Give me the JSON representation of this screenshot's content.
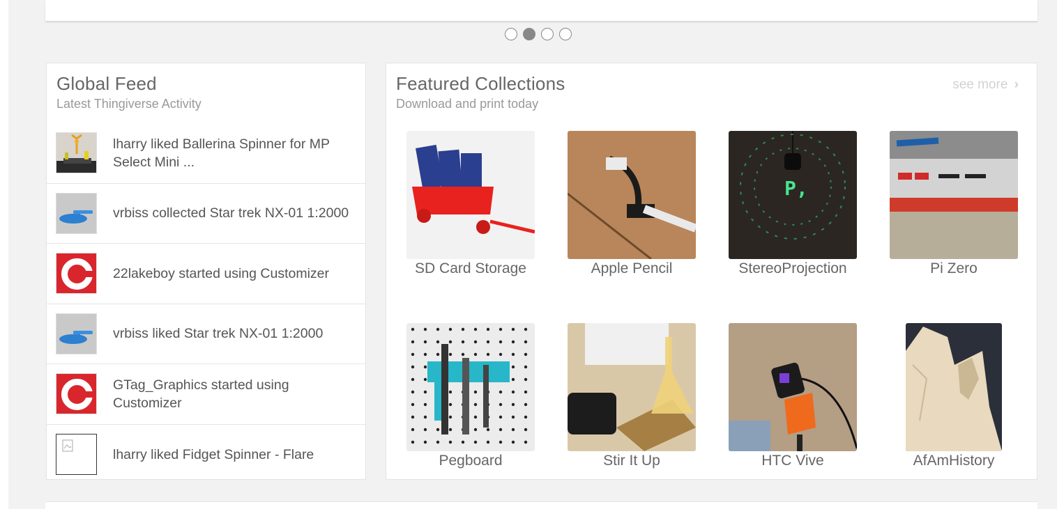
{
  "carousel": {
    "dots": 4,
    "active_index": 1
  },
  "global_feed": {
    "title": "Global Feed",
    "subtitle": "Latest Thingiverse Activity",
    "items": [
      {
        "text": "lharry liked Ballerina Spinner for MP Select Mini ...",
        "thumb": "ballerina-thumbnail"
      },
      {
        "text": "vrbiss collected Star trek NX-01 1:2000",
        "thumb": "starship-thumbnail"
      },
      {
        "text": "22lakeboy started using Customizer",
        "thumb": "customizer-logo"
      },
      {
        "text": "vrbiss liked Star trek NX-01 1:2000",
        "thumb": "starship-thumbnail"
      },
      {
        "text": "GTag_Graphics started using Customizer",
        "thumb": "customizer-logo"
      },
      {
        "text": "lharry liked Fidget Spinner - Flare",
        "thumb": "broken-image"
      }
    ]
  },
  "featured_collections": {
    "title": "Featured Collections",
    "subtitle": "Download and print today",
    "see_more": "see more",
    "items": [
      {
        "label": "SD Card Storage"
      },
      {
        "label": "Apple Pencil"
      },
      {
        "label": "StereoProjection"
      },
      {
        "label": "Pi Zero"
      },
      {
        "label": "Pegboard"
      },
      {
        "label": "Stir It Up"
      },
      {
        "label": "HTC Vive"
      },
      {
        "label": "AfAmHistory"
      }
    ]
  },
  "colors": {
    "customizer_red": "#d9262c",
    "page_bg": "#f2f2f2"
  }
}
